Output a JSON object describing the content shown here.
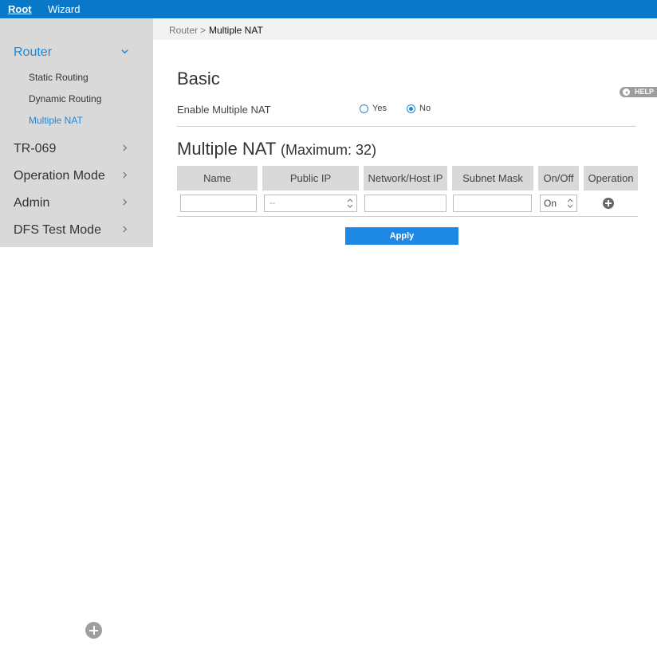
{
  "topbar": {
    "tabs": [
      "Root",
      "Wizard"
    ]
  },
  "sidebar": {
    "router": "Router",
    "router_items": [
      "Static Routing",
      "Dynamic Routing",
      "Multiple NAT"
    ],
    "sections": [
      "TR-069",
      "Operation Mode",
      "Admin",
      "DFS Test Mode"
    ]
  },
  "breadcrumb": {
    "parent": "Router",
    "separator": ">",
    "current": "Multiple NAT"
  },
  "basic": {
    "title": "Basic",
    "enable_label": "Enable Multiple NAT",
    "options": [
      "Yes",
      "No"
    ],
    "selected": "No"
  },
  "nat": {
    "title": "Multiple NAT",
    "subtitle": "(Maximum: 32)",
    "columns": [
      "Name",
      "Public IP",
      "Network/Host IP",
      "Subnet Mask",
      "On/Off",
      "Operation"
    ],
    "row": {
      "name": "",
      "public_ip": "--",
      "network_host_ip": "",
      "subnet_mask": "",
      "on_off": "On"
    }
  },
  "help": {
    "label": "HELP"
  },
  "apply": {
    "label": "Apply"
  },
  "icons": {
    "expand": "chevron-down-icon",
    "collapsed": "chevron-right-icon",
    "add": "plus-circle-icon",
    "help": "help-arrow-icon"
  },
  "colors": {
    "brand": "#0a78c8",
    "accent": "#1e88d8",
    "button": "#1e88e5",
    "sidebar": "#d9d9d9"
  }
}
